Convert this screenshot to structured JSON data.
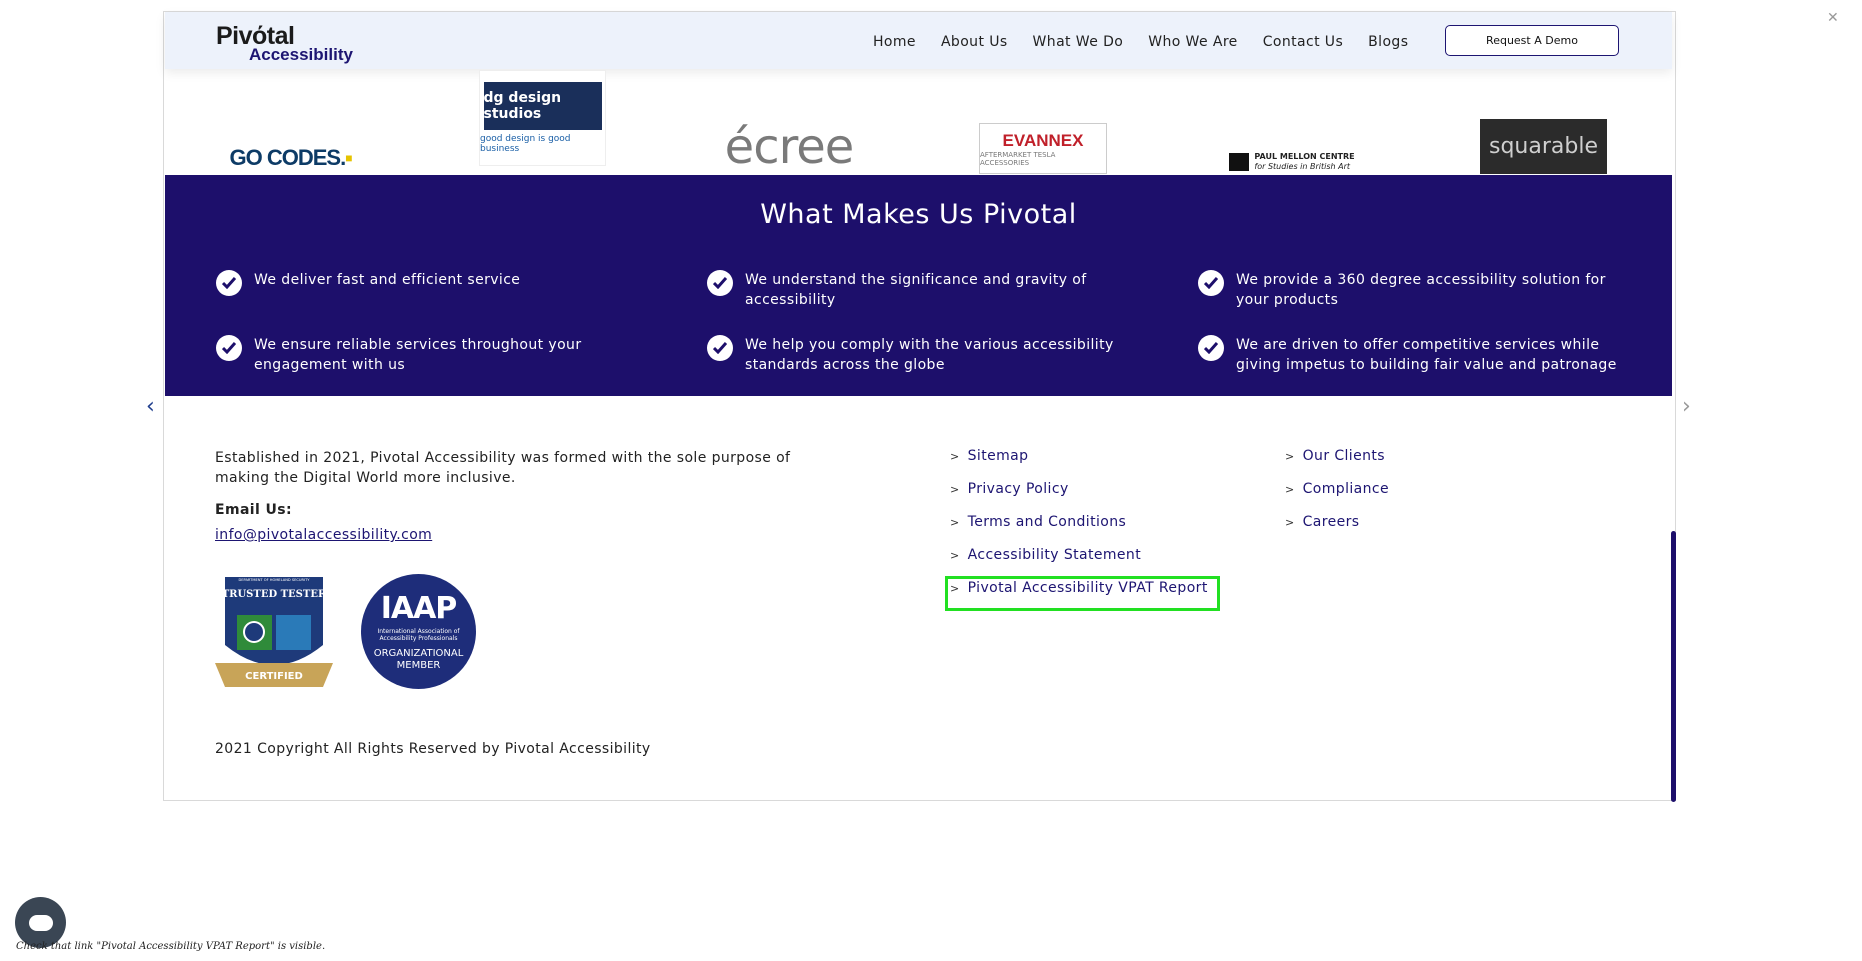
{
  "header": {
    "logo_top": "Pivόtal",
    "logo_bottom": "Accessibility",
    "nav": [
      "Home",
      "About Us",
      "What We Do",
      "Who We Are",
      "Contact Us",
      "Blogs"
    ],
    "demo_button": "Request A Demo"
  },
  "clients": {
    "gocodes": "GO CODES.",
    "dgdesign_box": "dg design studios",
    "dgdesign_tag": "good design is good business",
    "ecree": "écree",
    "evannex": "EVANNEX",
    "evannex_sub": "AFTERMARKET TESLA ACCESSORIES",
    "mellon_line1": "PAUL MELLON CENTRE",
    "mellon_line2": "for Studies in British Art",
    "squarable": "squarable"
  },
  "pivotal": {
    "title": "What Makes Us Pivotal",
    "features": [
      "We deliver fast and efficient service",
      "We understand the significance and gravity of accessibility",
      "We provide a 360 degree accessibility solution for your products",
      "We ensure reliable services throughout your engagement with us",
      "We help you comply with the various accessibility standards across the globe",
      "We are driven to offer competitive services while giving impetus to building fair value and patronage"
    ]
  },
  "footer": {
    "about": "Established in 2021, Pivotal Accessibility was formed with the sole purpose of making the Digital World more inclusive.",
    "email_label": "Email Us:",
    "email": "info@pivotalaccessibility.com",
    "badge_tester_top": "TRUSTED TESTER",
    "badge_tester_bottom": "CERTIFIED",
    "badge_tester_ring": "DEPARTMENT OF HOMELAND SECURITY",
    "badge_iaap_big": "IAAP",
    "badge_iaap_small": "International Association of Accessibility Professionals",
    "badge_iaap_org": "ORGANIZATIONAL MEMBER",
    "links_col1": [
      "Sitemap",
      "Privacy Policy",
      "Terms and Conditions",
      "Accessibility Statement",
      "Pivotal Accessibility VPAT Report"
    ],
    "links_col2": [
      "Our Clients",
      "Compliance",
      "Careers"
    ],
    "copyright": "2021 Copyright All Rights Reserved by Pivotal Accessibility"
  },
  "status_caption": "Check that link \"Pivotal Accessibility VPAT Report\" is visible.",
  "icons": {
    "prev": "chevron-left-icon",
    "next": "chevron-right-icon",
    "close": "close-icon",
    "chat": "chat-icon",
    "check": "check-circle-icon"
  },
  "colors": {
    "brand_purple": "#1d0f6b",
    "highlight_green": "#22e022",
    "header_bg": "#edf2fb"
  }
}
